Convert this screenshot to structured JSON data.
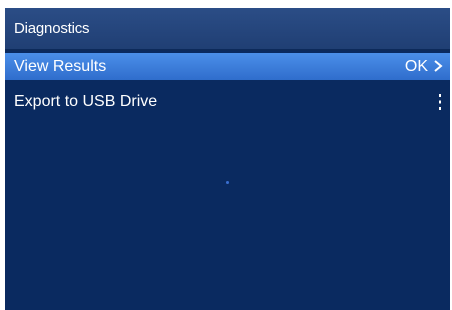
{
  "window": {
    "title": "Diagnostics"
  },
  "menu": {
    "items": [
      {
        "label": "View Results",
        "value": "OK",
        "icon": "chevron-right-icon",
        "selected": true
      },
      {
        "label": "Export to USB Drive",
        "icon": "kebab-menu-icon",
        "selected": false
      }
    ]
  },
  "colors": {
    "background": "#0a2a60",
    "title_bar": "#203f74",
    "selected": "#3b7de0",
    "text": "#ffffff"
  }
}
